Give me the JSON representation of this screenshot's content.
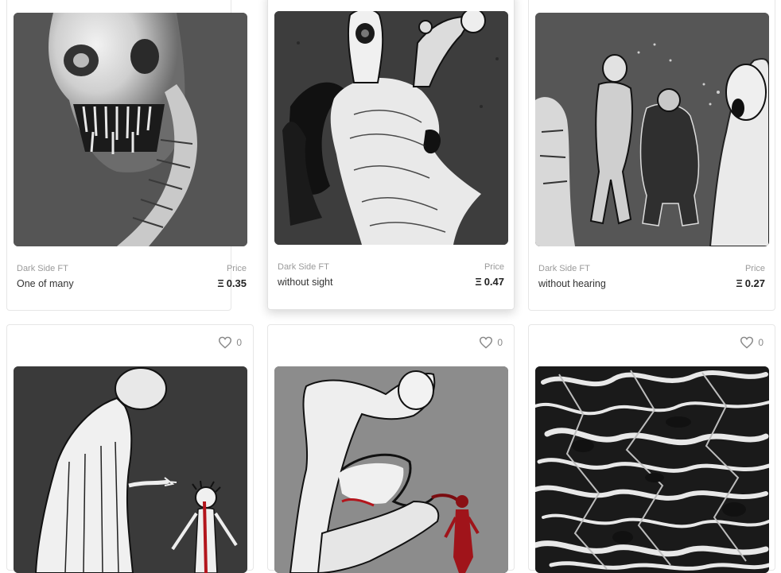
{
  "currency_symbol": "Ξ",
  "cards": [
    {
      "collection": "Dark Side FT",
      "title": "One of many",
      "price_label": "Price",
      "price": "0.35",
      "image": "skull-creature-artwork"
    },
    {
      "collection": "Dark Side FT",
      "title": "without sight",
      "price_label": "Price",
      "price": "0.47",
      "image": "faceless-figure-artwork"
    },
    {
      "collection": "Dark Side FT",
      "title": "without hearing",
      "price_label": "Price",
      "price": "0.27",
      "image": "screaming-figures-artwork"
    },
    {
      "likes": "0",
      "image": "robed-figure-artwork"
    },
    {
      "likes": "0",
      "image": "crouching-figure-artwork"
    },
    {
      "likes": "0",
      "image": "abstract-texture-artwork"
    }
  ],
  "colors": {
    "card_border": "#e6e6e6",
    "muted_text": "#9a9a9a",
    "blood_red": "#b3151c"
  }
}
